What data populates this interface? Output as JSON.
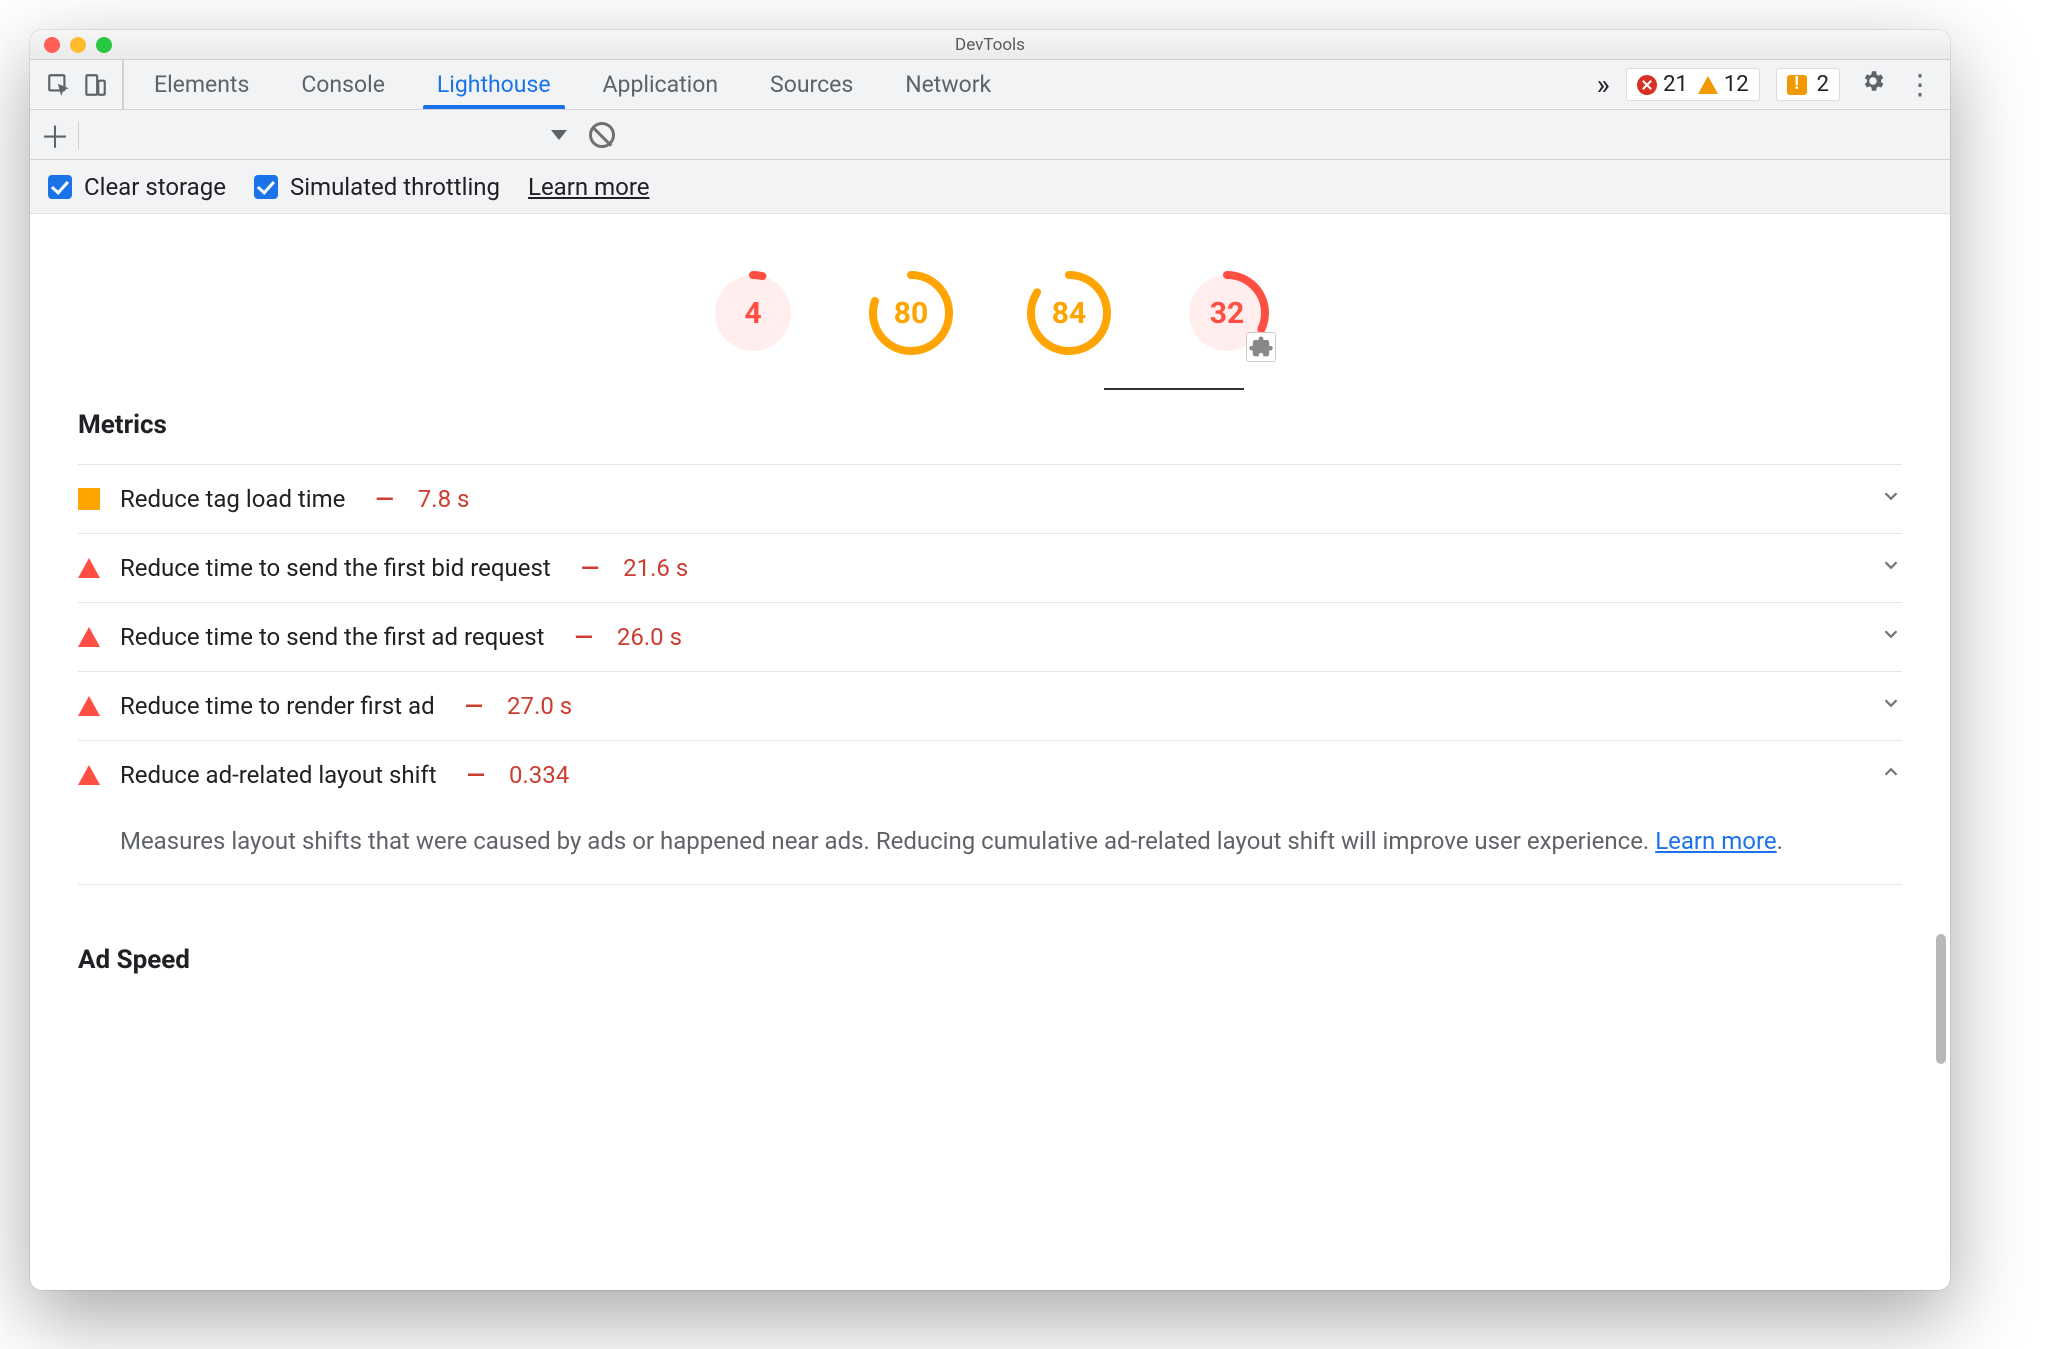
{
  "window": {
    "title": "DevTools"
  },
  "tabs": {
    "items": [
      "Elements",
      "Console",
      "Lighthouse",
      "Application",
      "Sources",
      "Network"
    ],
    "active": "Lighthouse"
  },
  "counters": {
    "errors": "21",
    "warnings": "12",
    "issues": "2"
  },
  "options": {
    "clear_storage": "Clear storage",
    "simulated_throttling": "Simulated throttling",
    "learn_more": "Learn more"
  },
  "scores": [
    {
      "value": "4",
      "level": "red",
      "pct": 4,
      "plugin": false
    },
    {
      "value": "80",
      "level": "orange",
      "pct": 80,
      "plugin": false
    },
    {
      "value": "84",
      "level": "orange",
      "pct": 84,
      "plugin": false
    },
    {
      "value": "32",
      "level": "red",
      "pct": 32,
      "plugin": true
    }
  ],
  "sections": {
    "metrics_title": "Metrics",
    "ad_speed_title": "Ad Speed"
  },
  "audits": [
    {
      "mark": "sq",
      "title": "Reduce tag load time",
      "value": "7.8 s",
      "expanded": false
    },
    {
      "mark": "tri",
      "title": "Reduce time to send the first bid request",
      "value": "21.6 s",
      "expanded": false
    },
    {
      "mark": "tri",
      "title": "Reduce time to send the first ad request",
      "value": "26.0 s",
      "expanded": false
    },
    {
      "mark": "tri",
      "title": "Reduce time to render first ad",
      "value": "27.0 s",
      "expanded": false
    },
    {
      "mark": "tri",
      "title": "Reduce ad-related layout shift",
      "value": "0.334",
      "expanded": true,
      "desc_pre": "Measures layout shifts that were caused by ads or happened near ads. Reducing cumulative ad-related layout shift will improve user experience. ",
      "desc_link": "Learn more",
      "desc_post": "."
    }
  ],
  "colors": {
    "red": "#ff4e42",
    "orange": "#ffa400",
    "redbg": "#ffeeed"
  }
}
